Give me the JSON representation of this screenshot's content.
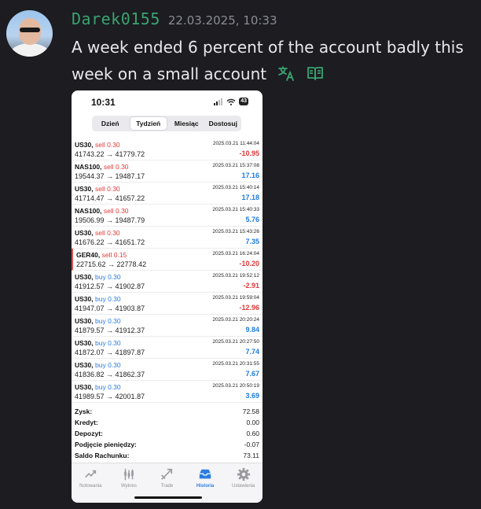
{
  "message": {
    "username": "Darek0155",
    "timestamp": "22.03.2025, 10:33",
    "text": "A week ended 6 percent of the account badly this week on a small account",
    "icons": [
      "translate-icon",
      "book-icon"
    ]
  },
  "phone": {
    "clock": "10:31",
    "battery": "43",
    "tabs": [
      "Dzień",
      "Tydzień",
      "Miesiąc",
      "Dostosuj"
    ],
    "active_tab": "Tydzień",
    "trades": [
      {
        "symbol": "US30,",
        "side": "sell 0.30",
        "type": "sell",
        "price": "41743.22 → 41779.72",
        "time": "2025.03.21 11:44:04",
        "pl": "-10.95",
        "sign": "neg"
      },
      {
        "symbol": "NAS100,",
        "side": "sell 0.30",
        "type": "sell",
        "price": "19544.37 → 19487.17",
        "time": "2025.03.21 15:37:08",
        "pl": "17.16",
        "sign": "pos"
      },
      {
        "symbol": "US30,",
        "side": "sell 0.30",
        "type": "sell",
        "price": "41714.47 → 41657.22",
        "time": "2025.03.21 15:40:14",
        "pl": "17.18",
        "sign": "pos"
      },
      {
        "symbol": "NAS100,",
        "side": "sell 0.30",
        "type": "sell",
        "price": "19506.99 → 19487.79",
        "time": "2025.03.21 15:40:33",
        "pl": "5.76",
        "sign": "pos"
      },
      {
        "symbol": "US30,",
        "side": "sell 0.30",
        "type": "sell",
        "price": "41676.22 → 41651.72",
        "time": "2025.03.21 15:43:26",
        "pl": "7.35",
        "sign": "pos"
      },
      {
        "symbol": "GER40,",
        "side": "sell 0.15",
        "type": "sell",
        "price": "22715.62 → 22778.42",
        "time": "2025.03.21 16:24:04",
        "pl": "-10.20",
        "sign": "neg"
      },
      {
        "symbol": "US30,",
        "side": "buy 0.30",
        "type": "buy",
        "price": "41912.57 → 41902.87",
        "time": "2025.03.21 19:52:12",
        "pl": "-2.91",
        "sign": "neg"
      },
      {
        "symbol": "US30,",
        "side": "buy 0.30",
        "type": "buy",
        "price": "41947.07 → 41903.87",
        "time": "2025.03.21 19:59:04",
        "pl": "-12.96",
        "sign": "neg"
      },
      {
        "symbol": "US30,",
        "side": "buy 0.30",
        "type": "buy",
        "price": "41879.57 → 41912.37",
        "time": "2025.03.21 20:20:24",
        "pl": "9.84",
        "sign": "pos"
      },
      {
        "symbol": "US30,",
        "side": "buy 0.30",
        "type": "buy",
        "price": "41872.07 → 41897.87",
        "time": "2025.03.21 20:27:50",
        "pl": "7.74",
        "sign": "pos"
      },
      {
        "symbol": "US30,",
        "side": "buy 0.30",
        "type": "buy",
        "price": "41836.82 → 41862.37",
        "time": "2025.03.21 20:31:55",
        "pl": "7.67",
        "sign": "pos"
      },
      {
        "symbol": "US30,",
        "side": "buy 0.30",
        "type": "buy",
        "price": "41989.57 → 42001.87",
        "time": "2025.03.21 20:50:19",
        "pl": "3.69",
        "sign": "pos"
      }
    ],
    "summary": [
      {
        "label": "Zysk:",
        "value": "72.58"
      },
      {
        "label": "Kredyt:",
        "value": "0.00"
      },
      {
        "label": "Depozyt:",
        "value": "0.60"
      },
      {
        "label": "Podjęcie pieniędzy:",
        "value": "-0.07"
      },
      {
        "label": "Saldo Rachunku:",
        "value": "73.11"
      }
    ],
    "tabbar": [
      {
        "label": "Notowania",
        "icon": "quotes-icon"
      },
      {
        "label": "Wykres",
        "icon": "chart-icon"
      },
      {
        "label": "Trade",
        "icon": "trade-icon"
      },
      {
        "label": "Historia",
        "icon": "history-icon"
      },
      {
        "label": "Ustawienia",
        "icon": "settings-icon"
      }
    ],
    "active_tabbar": "Historia"
  }
}
